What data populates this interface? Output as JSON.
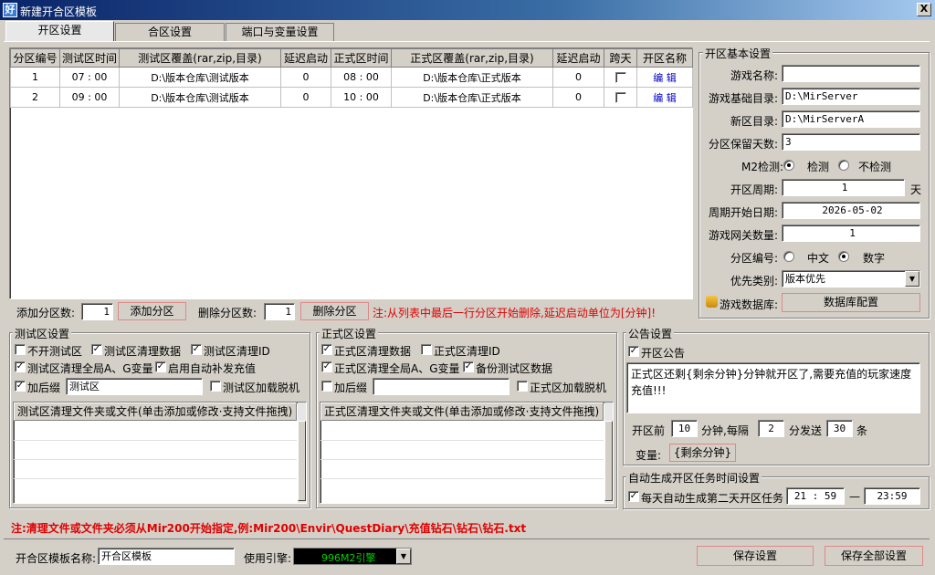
{
  "window": {
    "title": "新建开合区模板",
    "close": "X",
    "icon_text": "好"
  },
  "tabs": [
    "开区设置",
    "合区设置",
    "端口与变量设置"
  ],
  "table": {
    "headers": [
      "分区编号",
      "测试区时间",
      "测试区覆盖(rar,zip,目录)",
      "延迟启动",
      "正式区时间",
      "正式区覆盖(rar,zip,目录)",
      "延迟启动",
      "跨天",
      "开区名称"
    ],
    "rows": [
      {
        "id": "1",
        "test_time": "07 : 00",
        "test_cover": "D:\\版本仓库\\测试版本",
        "test_delay": "0",
        "formal_time": "08 : 00",
        "formal_cover": "D:\\版本仓库\\正式版本",
        "formal_delay": "0",
        "edit": "编  辑"
      },
      {
        "id": "2",
        "test_time": "09 : 00",
        "test_cover": "D:\\版本仓库\\测试版本",
        "test_delay": "0",
        "formal_time": "10 : 00",
        "formal_cover": "D:\\版本仓库\\正式版本",
        "formal_delay": "0",
        "edit": "编  辑"
      }
    ]
  },
  "add_row": {
    "add_label": "添加分区数:",
    "add_value": "1",
    "add_button": "添加分区",
    "del_label": "删除分区数:",
    "del_value": "1",
    "del_button": "删除分区",
    "note": "注:从列表中最后一行分区开始删除,延迟启动单位为[分钟]!"
  },
  "basic": {
    "title": "开区基本设置",
    "game_name_label": "游戏名称:",
    "game_name": "",
    "base_dir_label": "游戏基础目录:",
    "base_dir": "D:\\MirServer",
    "new_dir_label": "新区目录:",
    "new_dir": "D:\\MirServerA",
    "keep_days_label": "分区保留天数:",
    "keep_days": "3",
    "m2_label": "M2检测:",
    "m2_opt1": "检测",
    "m2_opt2": "不检测",
    "cycle_label": "开区周期:",
    "cycle": "1",
    "cycle_unit": "天",
    "start_date_label": "周期开始日期:",
    "start_date": "2026-05-02",
    "gateway_label": "游戏网关数量:",
    "gateway": "1",
    "numbering_label": "分区编号:",
    "num_opt1": "中文",
    "num_opt2": "数字",
    "priority_label": "优先类别:",
    "priority": "版本优先",
    "db_label": "游戏数据库:",
    "db_button": "数据库配置"
  },
  "test_zone": {
    "title": "测试区设置",
    "no_test": "不开测试区",
    "clean_data": "测试区清理数据",
    "clean_id": "测试区清理ID",
    "clean_global": "测试区清理全局A、G变量",
    "auto_recharge": "启用自动补发充值",
    "suffix_label": "加后缀",
    "suffix_value": "测试区",
    "offline": "测试区加载脱机",
    "list_header": "测试区清理文件夹或文件(单击添加或修改·支持文件拖拽)"
  },
  "formal_zone": {
    "title": "正式区设置",
    "clean_data": "正式区清理数据",
    "clean_id": "正式区清理ID",
    "clean_global": "正式区清理全局A、G变量",
    "backup": "备份测试区数据",
    "suffix_label": "加后缀",
    "suffix_value": "",
    "offline": "正式区加载脱机",
    "list_header": "正式区清理文件夹或文件(单击添加或修改·支持文件拖拽)"
  },
  "notice": {
    "title": "公告设置",
    "enable": "开区公告",
    "text": "正式区还剩{剩余分钟}分钟就开区了,需要充值的玩家速度充值!!!",
    "before_label": "开区前",
    "before_value": "10",
    "min_label": "分钟,每隔",
    "interval": "2",
    "send_label": "分发送",
    "count": "30",
    "count_unit": "条",
    "var_label": "变量:",
    "var_button": "{剩余分钟}"
  },
  "auto_task": {
    "title": "自动生成开区任务时间设置",
    "label": "每天自动生成第二天开区任务",
    "from": "21 : 59",
    "dash": "—",
    "to": "23:59"
  },
  "footer_note": "注:清理文件或文件夹必须从Mir200开始指定,例:Mir200\\Envir\\QuestDiary\\充值钻石\\钻石\\钻石.txt",
  "bottom": {
    "template_label": "开合区模板名称:",
    "template_name": "开合区模板",
    "engine_label": "使用引擎:",
    "engine": "996M2引擎",
    "save": "保存设置",
    "save_all": "保存全部设置"
  },
  "colors": {
    "title_start": "#0a246a",
    "title_end": "#a6caf0",
    "note_red": "#e00000",
    "engine_bg": "#000000",
    "engine_fg": "#00d000"
  }
}
